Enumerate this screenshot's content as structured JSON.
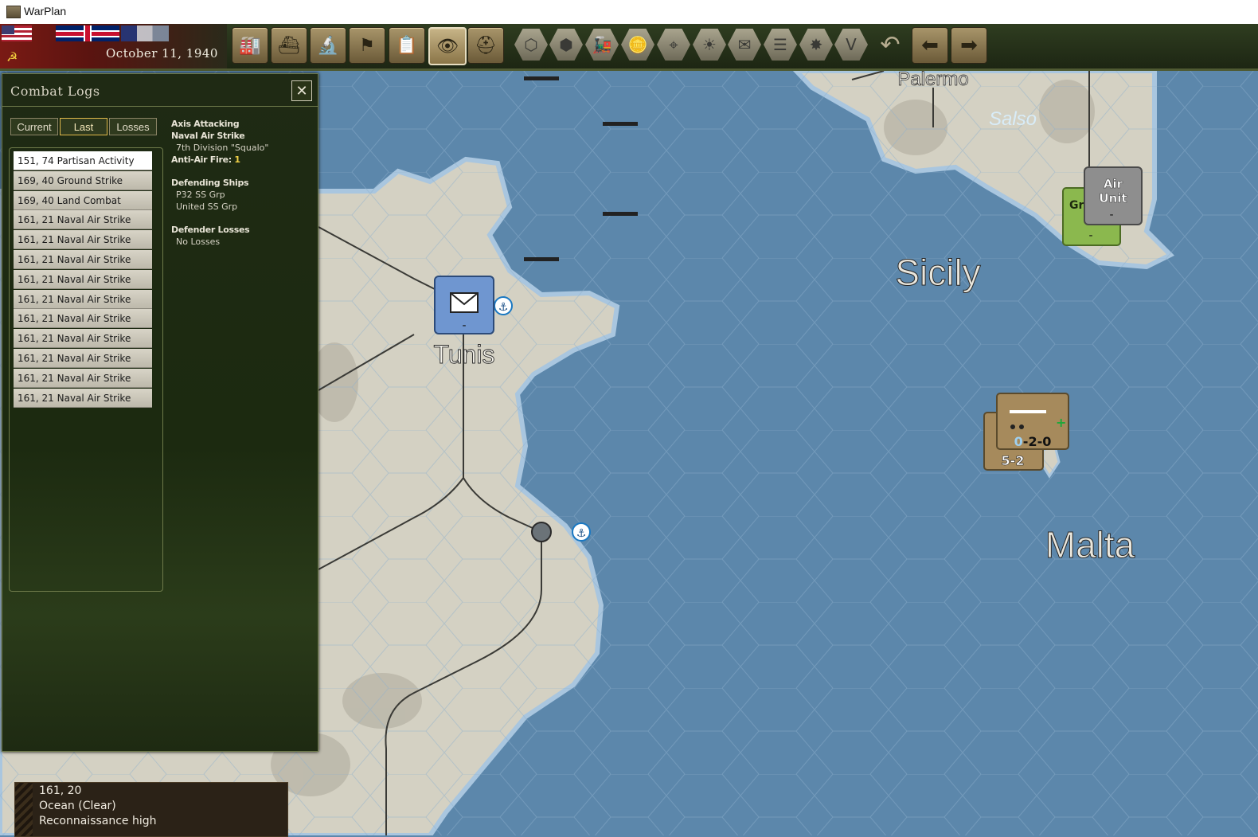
{
  "window": {
    "title": "WarPlan"
  },
  "topbar": {
    "date": "October 11, 1940",
    "toolbar_buttons": [
      {
        "name": "production-button",
        "icon": "factory-icon",
        "glyph": "🏭"
      },
      {
        "name": "naval-button",
        "icon": "ship-icon",
        "glyph": "⛴"
      },
      {
        "name": "research-button",
        "icon": "microscope-icon",
        "glyph": "🔬"
      },
      {
        "name": "diplomacy-button",
        "icon": "flag-icon",
        "glyph": "⚑"
      },
      {
        "name": "reports-button",
        "icon": "clipboard-icon",
        "glyph": "📋"
      },
      {
        "name": "recon-button",
        "icon": "binoculars-icon",
        "glyph": "👁"
      },
      {
        "name": "units-button",
        "icon": "helmet-icon",
        "glyph": "⛑"
      }
    ],
    "hex_buttons": [
      {
        "name": "hex-grid-button",
        "icon": "hexagon-icon",
        "glyph": "⬡"
      },
      {
        "name": "supply-hex-button",
        "icon": "hex-cluster-icon",
        "glyph": "⬢"
      },
      {
        "name": "rail-button",
        "icon": "train-icon",
        "glyph": "🚂"
      },
      {
        "name": "resources-button",
        "icon": "coins-icon",
        "glyph": "🪙"
      },
      {
        "name": "target-button",
        "icon": "crosshair-icon",
        "glyph": "⌖"
      },
      {
        "name": "weather-button",
        "icon": "sun-icon",
        "glyph": "☀"
      },
      {
        "name": "mail-filter-button",
        "icon": "envelope-icon",
        "glyph": "✉"
      },
      {
        "name": "lines-button",
        "icon": "railway-lines-icon",
        "glyph": "☰"
      },
      {
        "name": "explosion-button",
        "icon": "explosion-icon",
        "glyph": "✸"
      },
      {
        "name": "victory-button",
        "icon": "v-icon",
        "glyph": "V"
      }
    ]
  },
  "map": {
    "labels": {
      "palermo": "Palermo",
      "salso": "Salso",
      "sicily": "Sicily",
      "tunis": "Tunis",
      "malta": "Malta"
    },
    "units": {
      "air_unit_line1": "Air",
      "air_unit_line2": "Unit",
      "air_unit_bottom": "-",
      "green_unit_label": "Gr",
      "green_unit_bottom": "-",
      "hq_bottom": "-",
      "naval_top_a": "0",
      "naval_top_b": "-2-0",
      "naval_bottom": "5-2"
    }
  },
  "combat_logs": {
    "title": "Combat Logs",
    "tabs": [
      "Current",
      "Last",
      "Losses"
    ],
    "selected_tab": "Last",
    "entries": [
      "151, 74 Partisan Activity",
      "169, 40 Ground Strike",
      "169, 40 Land Combat",
      "161, 21 Naval Air Strike",
      "161, 21 Naval Air Strike",
      "161, 21 Naval Air Strike",
      "161, 21 Naval Air Strike",
      "161, 21 Naval Air Strike",
      "161, 21 Naval Air Strike",
      "161, 21 Naval Air Strike",
      "161, 21 Naval Air Strike",
      "161, 21 Naval Air Strike",
      "161, 21 Naval Air Strike"
    ],
    "details": {
      "attacker": "Axis Attacking",
      "strike_type": "Naval Air Strike",
      "unit": "7th Division \"Squalo\"",
      "aa_label": "Anti-Air Fire:",
      "aa_value": "1",
      "defending_heading": "Defending Ships",
      "ships": [
        "P32 SS Grp",
        "United SS Grp"
      ],
      "losses_heading": "Defender Losses",
      "losses": "No Losses"
    }
  },
  "info_box": {
    "coords": "161, 20",
    "terrain": "Ocean (Clear)",
    "recon": "Reconnaissance high"
  },
  "colors": {
    "sea": "#5c87ab",
    "land": "#d4d1c3",
    "panel_green": "#1f2a14",
    "hq_blue": "#6f96d0",
    "counter_tan": "#a68a5c",
    "air_grey": "#8e8e8e",
    "ground_green": "#8bb84e"
  }
}
